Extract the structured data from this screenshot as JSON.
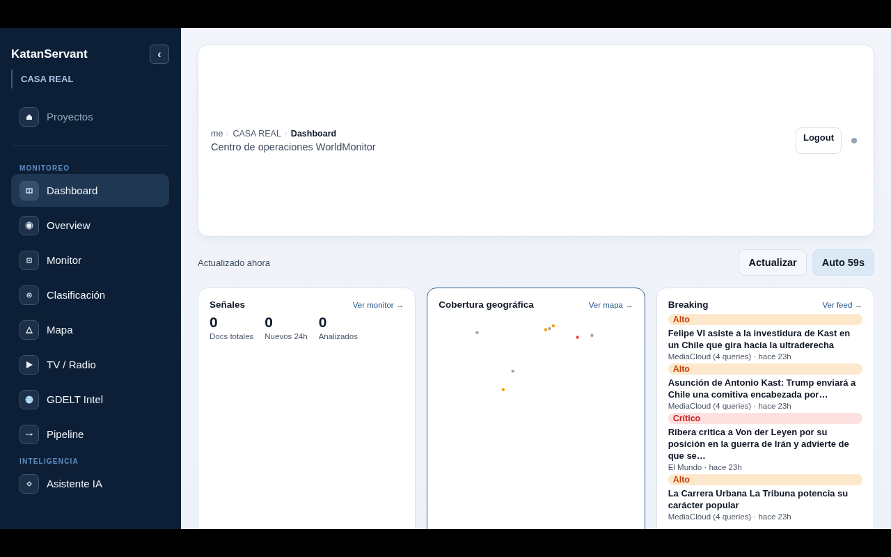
{
  "sidebar": {
    "brand": "KatanServant",
    "collapse_glyph": "‹",
    "workspace": "CASA REAL",
    "projects": {
      "label": "Proyectos"
    },
    "sections": [
      {
        "heading": "MONITOREO",
        "items": [
          {
            "label": "Dashboard",
            "selected": true
          },
          {
            "label": "Overview",
            "selected": false
          },
          {
            "label": "Monitor",
            "selected": false
          },
          {
            "label": "Clasificación",
            "selected": false
          },
          {
            "label": "Mapa",
            "selected": false
          },
          {
            "label": "TV / Radio",
            "selected": false
          },
          {
            "label": "GDELT Intel",
            "selected": false
          },
          {
            "label": "Pipeline",
            "selected": false
          }
        ]
      },
      {
        "heading": "INTELIGENCIA",
        "items": [
          {
            "label": "Asistente IA",
            "selected": false
          }
        ]
      }
    ]
  },
  "header": {
    "breadcrumb": [
      "me",
      "CASA REAL",
      "Dashboard"
    ],
    "subtitle": "Centro de operaciones WorldMonitor",
    "logout": "Logout"
  },
  "toolbar": {
    "status": "Actualizado ahora",
    "refresh": "Actualizar",
    "auto": "Auto 59s"
  },
  "signals": {
    "title": "Señales",
    "link": "Ver monitor →",
    "stats": [
      {
        "value": "0",
        "label": "Docs totales"
      },
      {
        "value": "0",
        "label": "Nuevos 24h"
      },
      {
        "value": "0",
        "label": "Analizados"
      }
    ]
  },
  "coverage": {
    "title": "Cobertura geográfica",
    "link": "Ver mapa →"
  },
  "breaking": {
    "title": "Breaking",
    "link": "Ver feed →",
    "items": [
      {
        "severity": "Alto",
        "kind": "high",
        "headline": "Felipe VI asiste a la investidura de Kast en un Chile que gira hacia la ultraderecha",
        "meta": "MediaCloud (4 queries) · hace 23h"
      },
      {
        "severity": "Alto",
        "kind": "high",
        "headline": "Asunción de Antonio Kast: Trump enviará a Chile una comitiva encabezada por…",
        "meta": "MediaCloud (4 queries) · hace 23h"
      },
      {
        "severity": "Crítico",
        "kind": "critical",
        "headline": "Ribera critica a Von der Leyen por su posición en la guerra de Irán y advierte de que se…",
        "meta": "El Mundo · hace 23h"
      },
      {
        "severity": "Alto",
        "kind": "high",
        "headline": "La Carrera Urbana La Tribuna potencia su carácter popular",
        "meta": "MediaCloud (4 queries) · hace 23h"
      }
    ]
  }
}
